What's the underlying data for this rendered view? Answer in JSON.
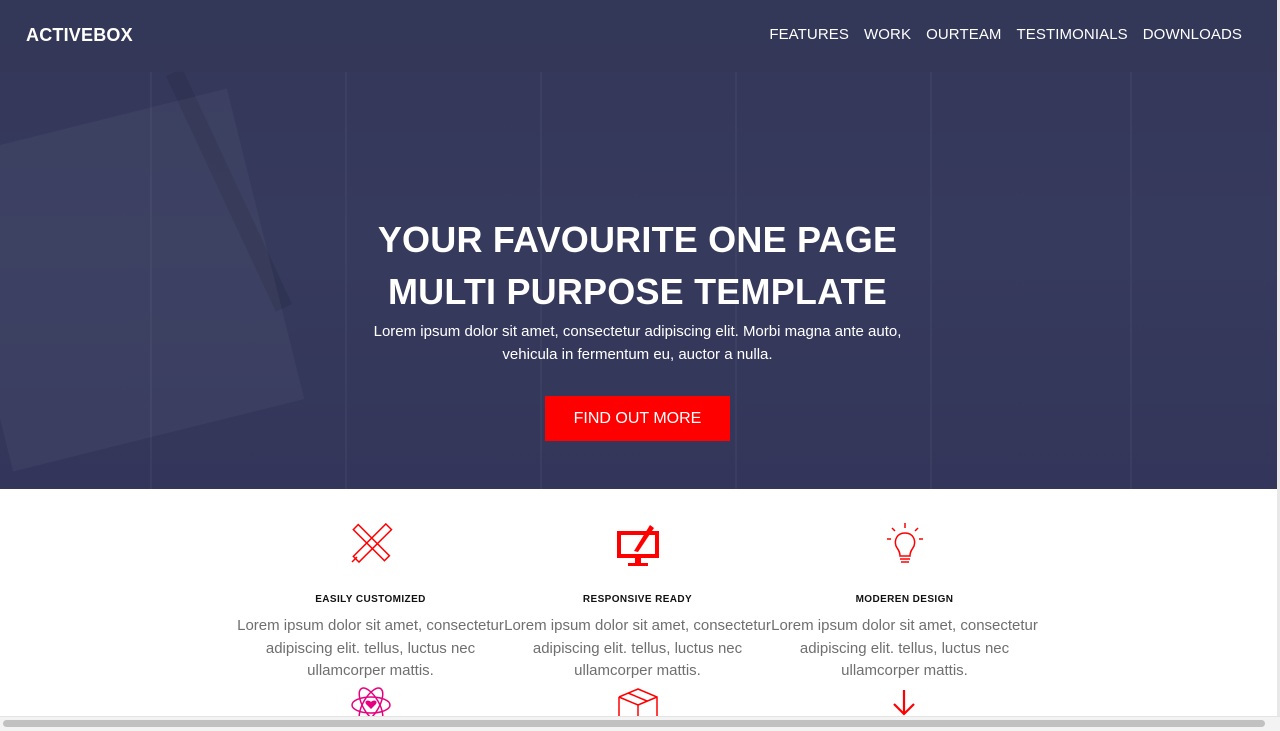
{
  "header": {
    "logo": "ACTIVEBOX",
    "nav": [
      "FEATURES",
      "WORK",
      "OURTEAM",
      "TESTIMONIALS",
      "DOWNLOADS"
    ]
  },
  "hero": {
    "title_line1": "YOUR FAVOURITE ONE PAGE",
    "title_line2": "MULTI PURPOSE TEMPLATE",
    "text": "Lorem ipsum dolor sit amet, consectetur adipiscing elit. Morbi magna ante auto, vehicula in fermentum eu, auctor a nulla.",
    "cta": "FIND OUT MORE"
  },
  "features": [
    {
      "title": "EASILY CUSTOMIZED",
      "text": "Lorem ipsum dolor sit amet, consectetur adipiscing elit. tellus, luctus nec ullamcorper mattis.",
      "icon": "pencil-ruler-icon"
    },
    {
      "title": "RESPONSIVE READY",
      "text": "Lorem ipsum dolor sit amet, consectetur adipiscing elit. tellus, luctus nec ullamcorper mattis.",
      "icon": "monitor-brush-icon"
    },
    {
      "title": "MODEREN DESIGN",
      "text": "Lorem ipsum dolor sit amet, consectetur adipiscing elit. tellus, luctus nec ullamcorper mattis.",
      "icon": "lightbulb-icon"
    }
  ],
  "colors": {
    "accent": "#ff0000",
    "hero_bg": "#363a5c",
    "muted_text": "#6f6f6f"
  }
}
